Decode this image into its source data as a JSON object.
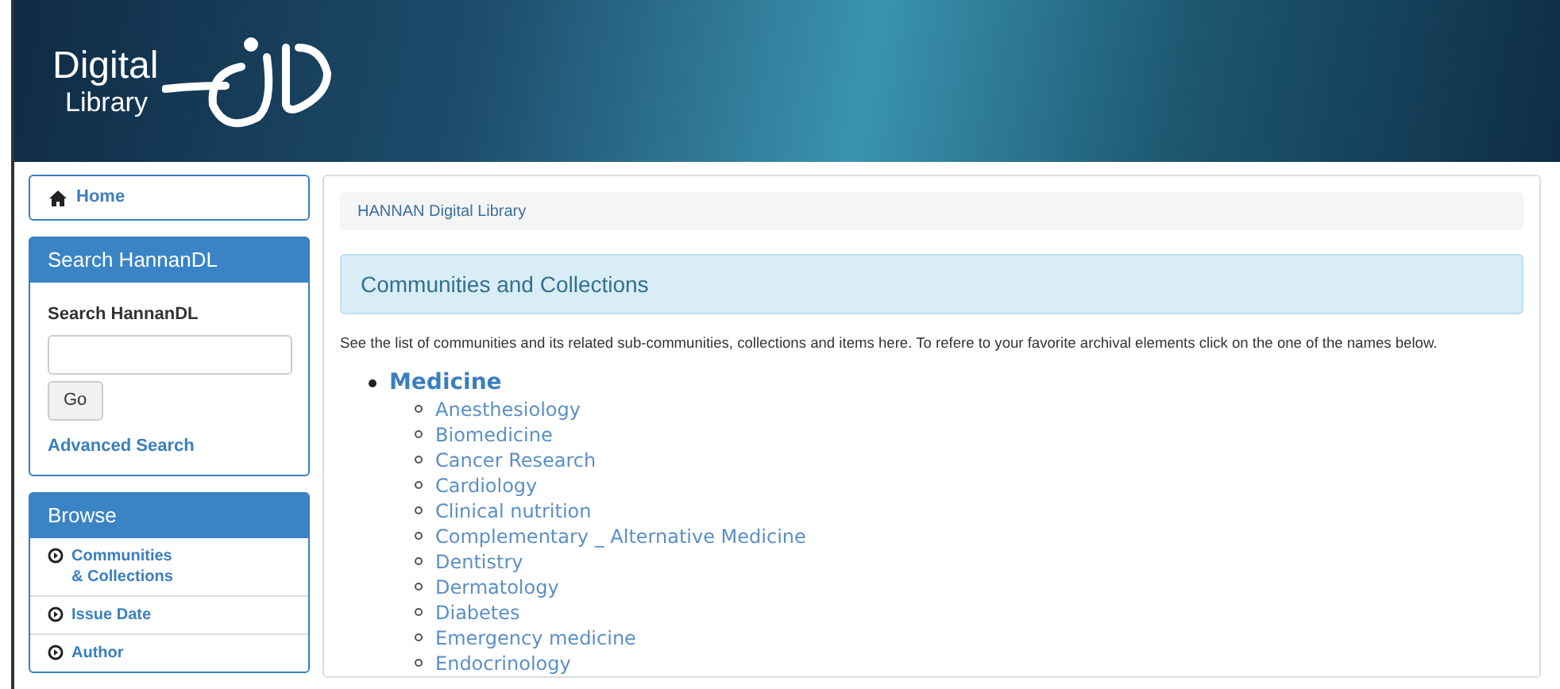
{
  "header": {
    "logo_line_1": "Digital",
    "logo_line_2": "Library"
  },
  "sidebar": {
    "home": {
      "label": "Home"
    },
    "search": {
      "title": "Search HannanDL",
      "field_label": "Search HannanDL",
      "button": "Go",
      "advanced_link": "Advanced Search"
    },
    "browse": {
      "title": "Browse",
      "items": [
        {
          "label": "Communities\n& Collections"
        },
        {
          "label": "Issue Date"
        },
        {
          "label": "Author"
        }
      ]
    }
  },
  "breadcrumb": "HANNAN Digital Library",
  "page_title": "Communities and Collections",
  "intro": "See the list of communities and its related sub-communities, collections and items here. To refere to your favorite archival elements click on the one of the names below.",
  "communities": [
    {
      "name": "Medicine",
      "children": [
        {
          "name": "Anesthesiology"
        },
        {
          "name": "Biomedicine"
        },
        {
          "name": "Cancer Research"
        },
        {
          "name": "Cardiology"
        },
        {
          "name": "Clinical nutrition"
        },
        {
          "name": "Complementary _ Alternative Medicine"
        },
        {
          "name": "Dentistry"
        },
        {
          "name": "Dermatology"
        },
        {
          "name": "Diabetes"
        },
        {
          "name": "Emergency medicine"
        },
        {
          "name": "Endocrinology"
        }
      ]
    }
  ]
}
